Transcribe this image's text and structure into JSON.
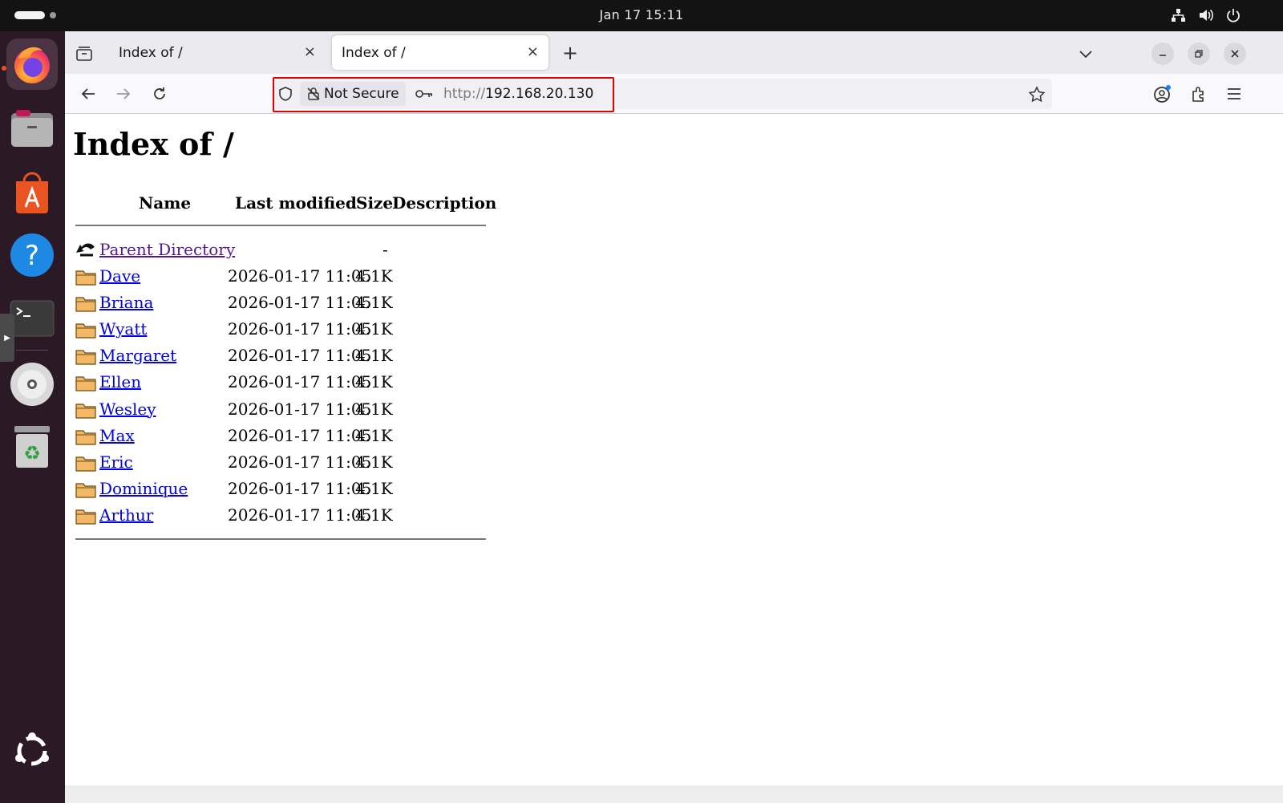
{
  "topbar": {
    "clock": "Jan 17  15:11"
  },
  "tabs": [
    {
      "title": "Index of /",
      "close": "×"
    },
    {
      "title": "Index of /",
      "close": "×"
    }
  ],
  "newtab": "+",
  "navbar": {
    "not_secure": "Not Secure",
    "url_proto": "http://",
    "url_host": "192.168.20.130"
  },
  "page": {
    "heading": "Index of /",
    "columns": {
      "name": "Name",
      "modified": "Last modified",
      "size": "Size",
      "description": "Description"
    },
    "parent": {
      "name": "Parent Directory",
      "size": "-"
    },
    "entries": [
      {
        "name": "Dave",
        "modified": "2026-01-17 11:05",
        "size": "4.1K"
      },
      {
        "name": "Briana",
        "modified": "2026-01-17 11:05",
        "size": "4.1K"
      },
      {
        "name": "Wyatt",
        "modified": "2026-01-17 11:05",
        "size": "4.1K"
      },
      {
        "name": "Margaret",
        "modified": "2026-01-17 11:05",
        "size": "4.1K"
      },
      {
        "name": "Ellen",
        "modified": "2026-01-17 11:05",
        "size": "4.1K"
      },
      {
        "name": "Wesley",
        "modified": "2026-01-17 11:05",
        "size": "4.1K"
      },
      {
        "name": "Max",
        "modified": "2026-01-17 11:05",
        "size": "4.1K"
      },
      {
        "name": "Eric",
        "modified": "2026-01-17 11:05",
        "size": "4.1K"
      },
      {
        "name": "Dominique",
        "modified": "2026-01-17 11:05",
        "size": "4.1K"
      },
      {
        "name": "Arthur",
        "modified": "2026-01-17 11:05",
        "size": "4.1K"
      }
    ]
  },
  "colors": {
    "link": "#0000ee",
    "visited": "#551a8b",
    "dock_bg": "#2b1a26",
    "url_highlight": "#e00000"
  },
  "icons": {
    "topbar": [
      "network-icon",
      "volume-icon",
      "power-icon"
    ],
    "dock": [
      "firefox-icon",
      "files-icon",
      "app-center-icon",
      "help-icon",
      "terminal-icon",
      "disc-icon",
      "trash-icon",
      "ubuntu-logo-icon"
    ],
    "toolbar": [
      "back-icon",
      "forward-icon",
      "reload-icon",
      "shield-icon",
      "lock-slash-icon",
      "key-icon",
      "bookmark-star-icon",
      "account-icon",
      "extensions-icon",
      "menu-icon"
    ]
  }
}
